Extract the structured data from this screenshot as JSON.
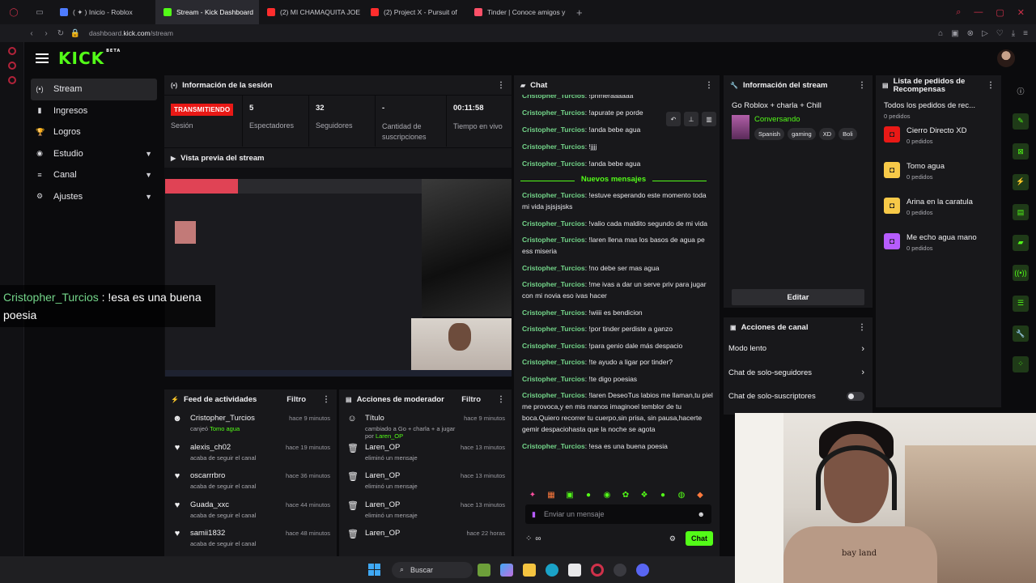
{
  "browser": {
    "tabs": [
      {
        "label": "( ✦ ) Inicio - Roblox",
        "color": "#4e7cff"
      },
      {
        "label": "Stream - Kick Dashboard",
        "color": "#53fc18",
        "active": true
      },
      {
        "label": "(2) MI CHAMAQUITA JOE",
        "color": "#ff2d2d"
      },
      {
        "label": "(2) Project X - Pursuit of",
        "color": "#ff2d2d"
      },
      {
        "label": "Tinder | Conoce amigos y",
        "color": "#fd5068"
      }
    ],
    "url_prefix": "dashboard.",
    "url_domain": "kick.com",
    "url_path": "/stream"
  },
  "kick": {
    "logo": "KICK",
    "beta": "BETA"
  },
  "leftnav": {
    "items": [
      {
        "label": "Stream",
        "icon": "(•)"
      },
      {
        "label": "Ingresos",
        "icon": "▮"
      },
      {
        "label": "Logros",
        "icon": "🏆"
      },
      {
        "label": "Estudio",
        "icon": "◉"
      },
      {
        "label": "Canal",
        "icon": "≡"
      },
      {
        "label": "Ajustes",
        "icon": "⚙"
      }
    ]
  },
  "session": {
    "header": "Información de la sesión",
    "status": "TRANSMITIENDO",
    "status_label": "Sesión",
    "viewers": "5",
    "viewers_label": "Espectadores",
    "followers": "32",
    "followers_label": "Seguidores",
    "subs": "-",
    "subs_label": "Cantidad de suscripciones",
    "time": "00:11:58",
    "time_label": "Tiempo en vivo"
  },
  "preview": {
    "header": "Vista previa del stream"
  },
  "overlay": {
    "user": "Cristopher_Turcios",
    "sep": " : ",
    "text": "!esa es una buena poesia"
  },
  "activity": {
    "header": "Feed de actividades",
    "filter": "Filtro",
    "items": [
      {
        "name": "Cristopher_Turcios",
        "pre": "canjeó ",
        "hl": "Tomo agua",
        "post": "",
        "time": "hace 9 minutos",
        "icon": "☻"
      },
      {
        "name": "alexis_ch02",
        "pre": "acaba de seguir el canal",
        "hl": "",
        "post": "",
        "time": "hace 19 minutos",
        "icon": "♥"
      },
      {
        "name": "oscarrrbro",
        "pre": "acaba de seguir el canal",
        "hl": "",
        "post": "",
        "time": "hace 36 minutos",
        "icon": "♥"
      },
      {
        "name": "Guada_xxc",
        "pre": "acaba de seguir el canal",
        "hl": "",
        "post": "",
        "time": "hace 44 minutos",
        "icon": "♥"
      },
      {
        "name": "samii1832",
        "pre": "acaba de seguir el canal",
        "hl": "",
        "post": "",
        "time": "hace 48 minutos",
        "icon": "♥"
      }
    ]
  },
  "moderator": {
    "header": "Acciones de moderador",
    "filter": "Filtro",
    "items": [
      {
        "name": "Título",
        "pre": "cambiado a Go + charla + a jugar por ",
        "hl": "Laren_OP",
        "time": "hace 9 minutos",
        "icon": "☺"
      },
      {
        "name": "Laren_OP",
        "pre": "eliminó un mensaje",
        "hl": "",
        "time": "hace 13 minutos",
        "icon": "🗑"
      },
      {
        "name": "Laren_OP",
        "pre": "eliminó un mensaje",
        "hl": "",
        "time": "hace 13 minutos",
        "icon": "🗑"
      },
      {
        "name": "Laren_OP",
        "pre": "eliminó un mensaje",
        "hl": "",
        "time": "hace 13 minutos",
        "icon": "🗑"
      },
      {
        "name": "Laren_OP",
        "pre": "",
        "hl": "",
        "time": "hace 22 horas",
        "icon": "🗑"
      }
    ]
  },
  "chat": {
    "header": "Chat",
    "divider": "Nuevos mensajes",
    "messages_before": [
      {
        "user": "Cristopher_Turcios",
        "text": "!primeraaaaaa"
      },
      {
        "user": "Cristopher_Turcios",
        "text": "!apurate pe porde"
      },
      {
        "user": "Cristopher_Turcios",
        "text": "!anda bebe agua"
      },
      {
        "user": "Cristopher_Turcios",
        "text": "!jjjj"
      },
      {
        "user": "Cristopher_Turcios",
        "text": "!anda bebe agua"
      }
    ],
    "messages_after": [
      {
        "user": "Cristopher_Turcios",
        "text": "!estuve esperando este momento toda mi vida jsjsjsjsks"
      },
      {
        "user": "Cristopher_Turcios",
        "text": "!valio cada maldito segundo de mi vida"
      },
      {
        "user": "Cristopher_Turcios",
        "text": "!laren llena mas los basos de agua pe ess miseria"
      },
      {
        "user": "Cristopher_Turcios",
        "text": "!no debe ser mas agua"
      },
      {
        "user": "Cristopher_Turcios",
        "text": "!me ivas a dar un serve priv para jugar con mi novia eso ivas hacer"
      },
      {
        "user": "Cristopher_Turcios",
        "text": "!wiiii es bendicion"
      },
      {
        "user": "Cristopher_Turcios",
        "text": "!por tinder perdiste a ganzo"
      },
      {
        "user": "Cristopher_Turcios",
        "text": "!para genio dale más despacio"
      },
      {
        "user": "Cristopher_Turcios",
        "text": "!te ayudo a ligar por tinder?"
      },
      {
        "user": "Cristopher_Turcios",
        "text": "!te digo poesias"
      },
      {
        "user": "Cristopher_Turcios",
        "text": "!laren DeseoTus labios me llaman,tu piel me provoca,y en mis manos imaginoel temblor de tu boca.Quiero recorrer tu cuerpo,sin prisa, sin pausa,hacerte gemir despaciohasta que la noche se agota"
      },
      {
        "user": "Cristopher_Turcios",
        "text": "!esa es una buena poesia"
      }
    ],
    "input_placeholder": "Enviar un mensaje",
    "send": "Chat"
  },
  "stream_info": {
    "header": "Información del stream",
    "title": "Go Roblox + charla + Chill",
    "category": "Conversando",
    "tags": [
      "Spanish",
      "gaming",
      "XD",
      "Boli"
    ],
    "edit": "Editar"
  },
  "rewards": {
    "header": "Lista de pedidos de Recompensas",
    "all": "Todos los pedidos de rec...",
    "all_count": "0 pedidos",
    "items": [
      {
        "name": "Cierro Directo XD",
        "count": "0 pedidos",
        "color": "#e91916"
      },
      {
        "name": "Tomo agua",
        "count": "0 pedidos",
        "color": "#f7c948"
      },
      {
        "name": "Arina en la caratula",
        "count": "0 pedidos",
        "color": "#f7c948"
      },
      {
        "name": "Me echo agua mano",
        "count": "0 pedidos",
        "color": "#b65cff"
      }
    ]
  },
  "channel_actions": {
    "header": "Acciones de canal",
    "items": [
      {
        "label": "Modo lento",
        "kind": "arrow"
      },
      {
        "label": "Chat de solo-seguidores",
        "kind": "arrow"
      },
      {
        "label": "Chat de solo-suscriptores",
        "kind": "toggle"
      }
    ]
  },
  "webcam": {
    "shirt_text": "bay land"
  },
  "taskbar": {
    "search": "Buscar"
  },
  "colors": {
    "accent": "#53fc18",
    "live": "#e91916",
    "username": "#74d68a"
  }
}
